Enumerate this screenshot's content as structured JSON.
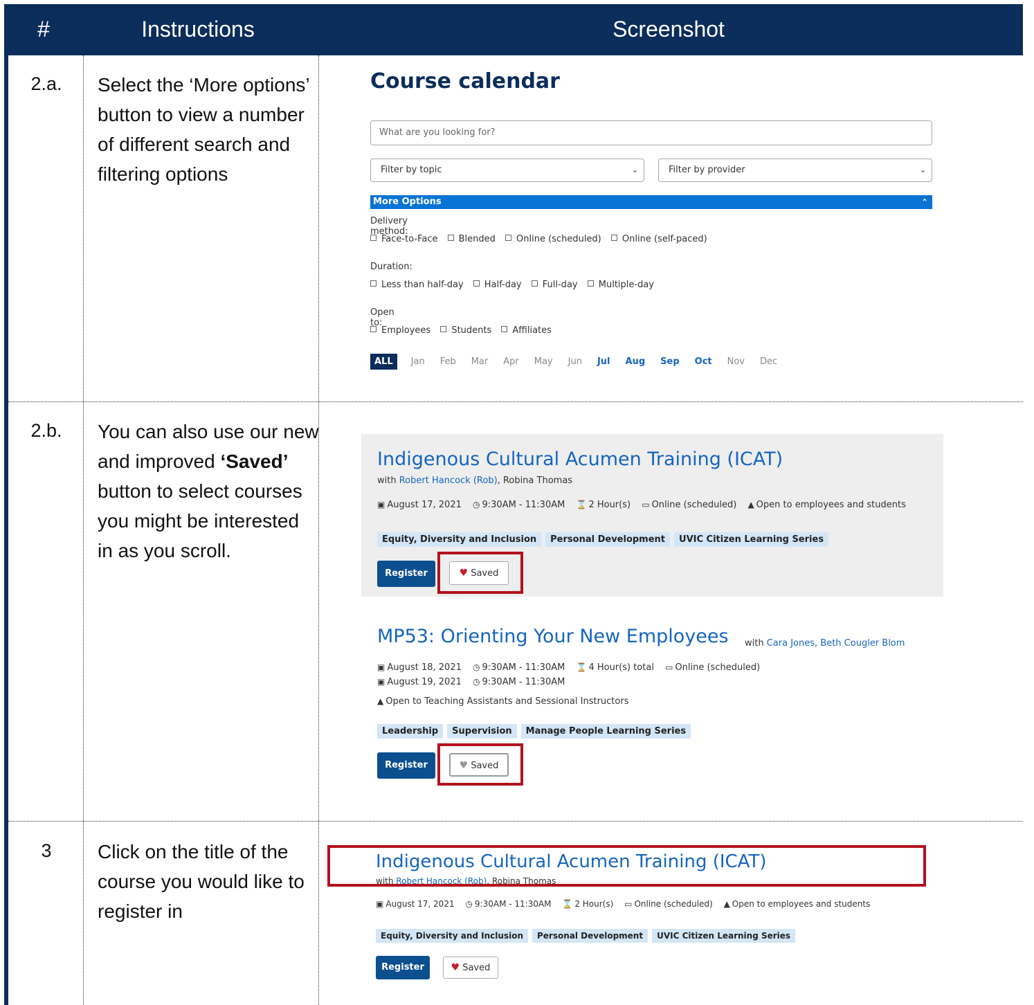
{
  "header": {
    "num": "#",
    "instructions": "Instructions",
    "screenshot": "Screenshot"
  },
  "rows": [
    {
      "num": "2.a.",
      "text": "Select the ‘More options’ button to view a number of different search and filtering options"
    },
    {
      "num": "2.b.",
      "text_pre": "You can also use our new and improved ",
      "text_bold": "‘Saved’",
      "text_post": " button to select courses you might be interested in as you scroll."
    },
    {
      "num": "3",
      "text": "Click on the title of the course you would like to register in"
    }
  ],
  "calendar": {
    "title": "Course calendar",
    "search_placeholder": "What are you looking for?",
    "filter_topic": "Filter by topic",
    "filter_provider": "Filter by provider",
    "more_options": "More Options",
    "delivery_label": "Delivery method:",
    "delivery": [
      "Face-to-Face",
      "Blended",
      "Online (scheduled)",
      "Online (self-paced)"
    ],
    "duration_label": "Duration:",
    "duration": [
      "Less than half-day",
      "Half-day",
      "Full-day",
      "Multiple-day"
    ],
    "open_label": "Open to:",
    "open_to": [
      "Employees",
      "Students",
      "Affiliates"
    ],
    "months": [
      "ALL",
      "Jan",
      "Feb",
      "Mar",
      "Apr",
      "May",
      "Jun",
      "Jul",
      "Aug",
      "Sep",
      "Oct",
      "Nov",
      "Dec"
    ],
    "active_months": [
      "Jul",
      "Aug",
      "Sep",
      "Oct"
    ]
  },
  "course1": {
    "title": "Indigenous Cultural Acumen Training (ICAT)",
    "with": "with",
    "instructor1": "Robert Hancock (Rob)",
    "instructor2": ", Robina Thomas",
    "date": "August 17, 2021",
    "time": "9:30AM - 11:30AM",
    "duration": "2 Hour(s)",
    "mode": "Online (scheduled)",
    "open": "Open to employees and students",
    "tags": [
      "Equity, Diversity and Inclusion",
      "Personal Development",
      "UVIC Citizen Learning Series"
    ],
    "register": "Register",
    "saved": "Saved"
  },
  "course2": {
    "title": "MP53: Orienting Your New Employees",
    "with": "with",
    "instructors": "Cara Jones, Beth Cougler Blom",
    "date1": "August 18, 2021",
    "time1": "9:30AM - 11:30AM",
    "duration": "4 Hour(s) total",
    "mode": "Online (scheduled)",
    "date2": "August 19, 2021",
    "time2": "9:30AM - 11:30AM",
    "open": "Open to Teaching Assistants and Sessional Instructors",
    "tags": [
      "Leadership",
      "Supervision",
      "Manage People Learning Series"
    ],
    "register": "Register",
    "saved": "Saved"
  }
}
